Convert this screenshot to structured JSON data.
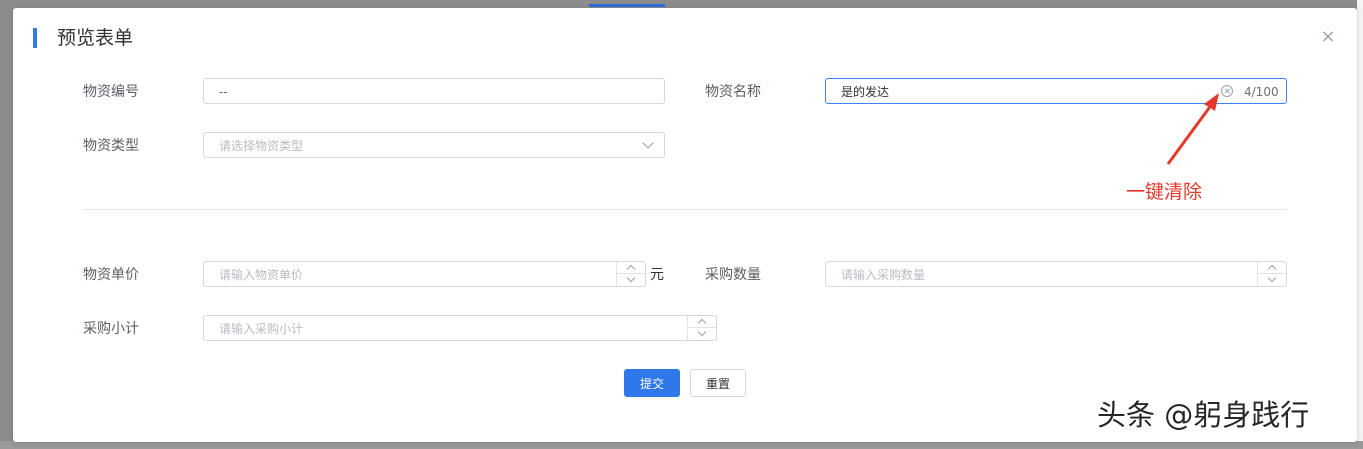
{
  "dialog": {
    "title": "预览表单",
    "close_icon": "×"
  },
  "form": {
    "material_code": {
      "label": "物资编号",
      "value": "--"
    },
    "material_name": {
      "label": "物资名称",
      "value": "是的发达",
      "counter": "4/100"
    },
    "material_type": {
      "label": "物资类型",
      "placeholder": "请选择物资类型"
    },
    "unit_price": {
      "label": "物资单价",
      "placeholder": "请输入物资单价",
      "unit": "元"
    },
    "purchase_qty": {
      "label": "采购数量",
      "placeholder": "请输入采购数量"
    },
    "subtotal": {
      "label": "采购小计",
      "placeholder": "请输入采购小计"
    }
  },
  "actions": {
    "submit_label": "提交",
    "reset_label": "重置"
  },
  "annotation": {
    "text": "一键清除",
    "color": "#e33a2c"
  },
  "watermark": {
    "text": "头条 @躬身践行"
  },
  "colors": {
    "accent": "#2f78ec",
    "focus_border": "#3b82f6"
  }
}
